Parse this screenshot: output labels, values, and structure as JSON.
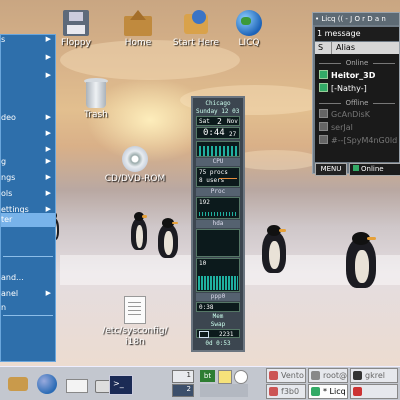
{
  "desktop": {
    "icons": [
      {
        "label": "Floppy",
        "icon": "floppy-icon"
      },
      {
        "label": "Home",
        "icon": "home-folder-icon"
      },
      {
        "label": "Start Here",
        "icon": "start-here-icon"
      },
      {
        "label": "LICQ",
        "icon": "globe-icon"
      },
      {
        "label": "Trash",
        "icon": "trash-icon"
      },
      {
        "label": "CD/DVD-ROM",
        "icon": "cdrom-icon"
      },
      {
        "label": "/etc/sysconfig/\ni18n",
        "icon": "text-file-icon"
      }
    ]
  },
  "start_menu": {
    "items": [
      {
        "label": "s",
        "submenu": true
      },
      {
        "label": "",
        "submenu": true
      },
      {
        "label": "",
        "submenu": true
      },
      {
        "label": "deo",
        "submenu": true
      },
      {
        "label": "",
        "submenu": true
      },
      {
        "label": "",
        "submenu": true
      },
      {
        "label": "g",
        "submenu": true
      },
      {
        "label": "ngs",
        "submenu": true
      },
      {
        "label": "ols",
        "submenu": true
      },
      {
        "label": "ettings",
        "submenu": true
      },
      {
        "label": "ter",
        "submenu": false,
        "selected": true
      },
      {
        "label": "and...",
        "submenu": false
      },
      {
        "label": "anel",
        "submenu": true
      },
      {
        "label": "n",
        "submenu": false
      }
    ]
  },
  "gkrellm": {
    "location": "Chicago",
    "date_line": "Sunday 12 03 14",
    "day": "Sat",
    "date": "2",
    "month": "Nov",
    "time": "0:44",
    "seconds": "27",
    "cpu_label": "CPU",
    "procs_line": "75 procs",
    "users_line": "8 users",
    "proc_label": "Proc",
    "proc_value": "192",
    "disk_label": "hda",
    "net_value": "10",
    "net_label": "ppp0",
    "mem_label": "0:38",
    "mem_value": "Mem",
    "swap_label": "Swap",
    "mail_label": "2231",
    "uptime": "0d 0:53"
  },
  "licq": {
    "title": "• Licq (( - J O r D a n",
    "messages": "1 message",
    "column_s": "S",
    "column_alias": "Alias",
    "group_online": "Online",
    "group_offline": "Offline",
    "online_contacts": [
      "Heitor_3D",
      "[-Nathy-]"
    ],
    "offline_contacts": [
      "GcAnDisK",
      "serJal",
      "#--[SpyM4nG0ld"
    ],
    "menu_button": "MENU",
    "status": "Online"
  },
  "panel": {
    "launchers": [
      "main-menu-icon",
      "web-browser-icon",
      "mail-icon",
      "printer-icon",
      "terminal-icon"
    ],
    "workspaces": [
      "1",
      "2"
    ],
    "applets": [
      "bt",
      "notes-icon",
      "clock-icon"
    ],
    "tasks": [
      {
        "label": "Vento",
        "active": false
      },
      {
        "label": "root@",
        "active": false
      },
      {
        "label": "gkrel",
        "active": false
      },
      {
        "label": "f3b0",
        "active": false
      },
      {
        "label": "* Licq",
        "active": true
      },
      {
        "label": "",
        "active": false
      }
    ]
  },
  "colors": {
    "menu_bg": "#2e6fab",
    "menu_selected": "#78b3ea",
    "panel_bg": "#c3c7cf",
    "gk_graph": "#1fb0a0"
  }
}
